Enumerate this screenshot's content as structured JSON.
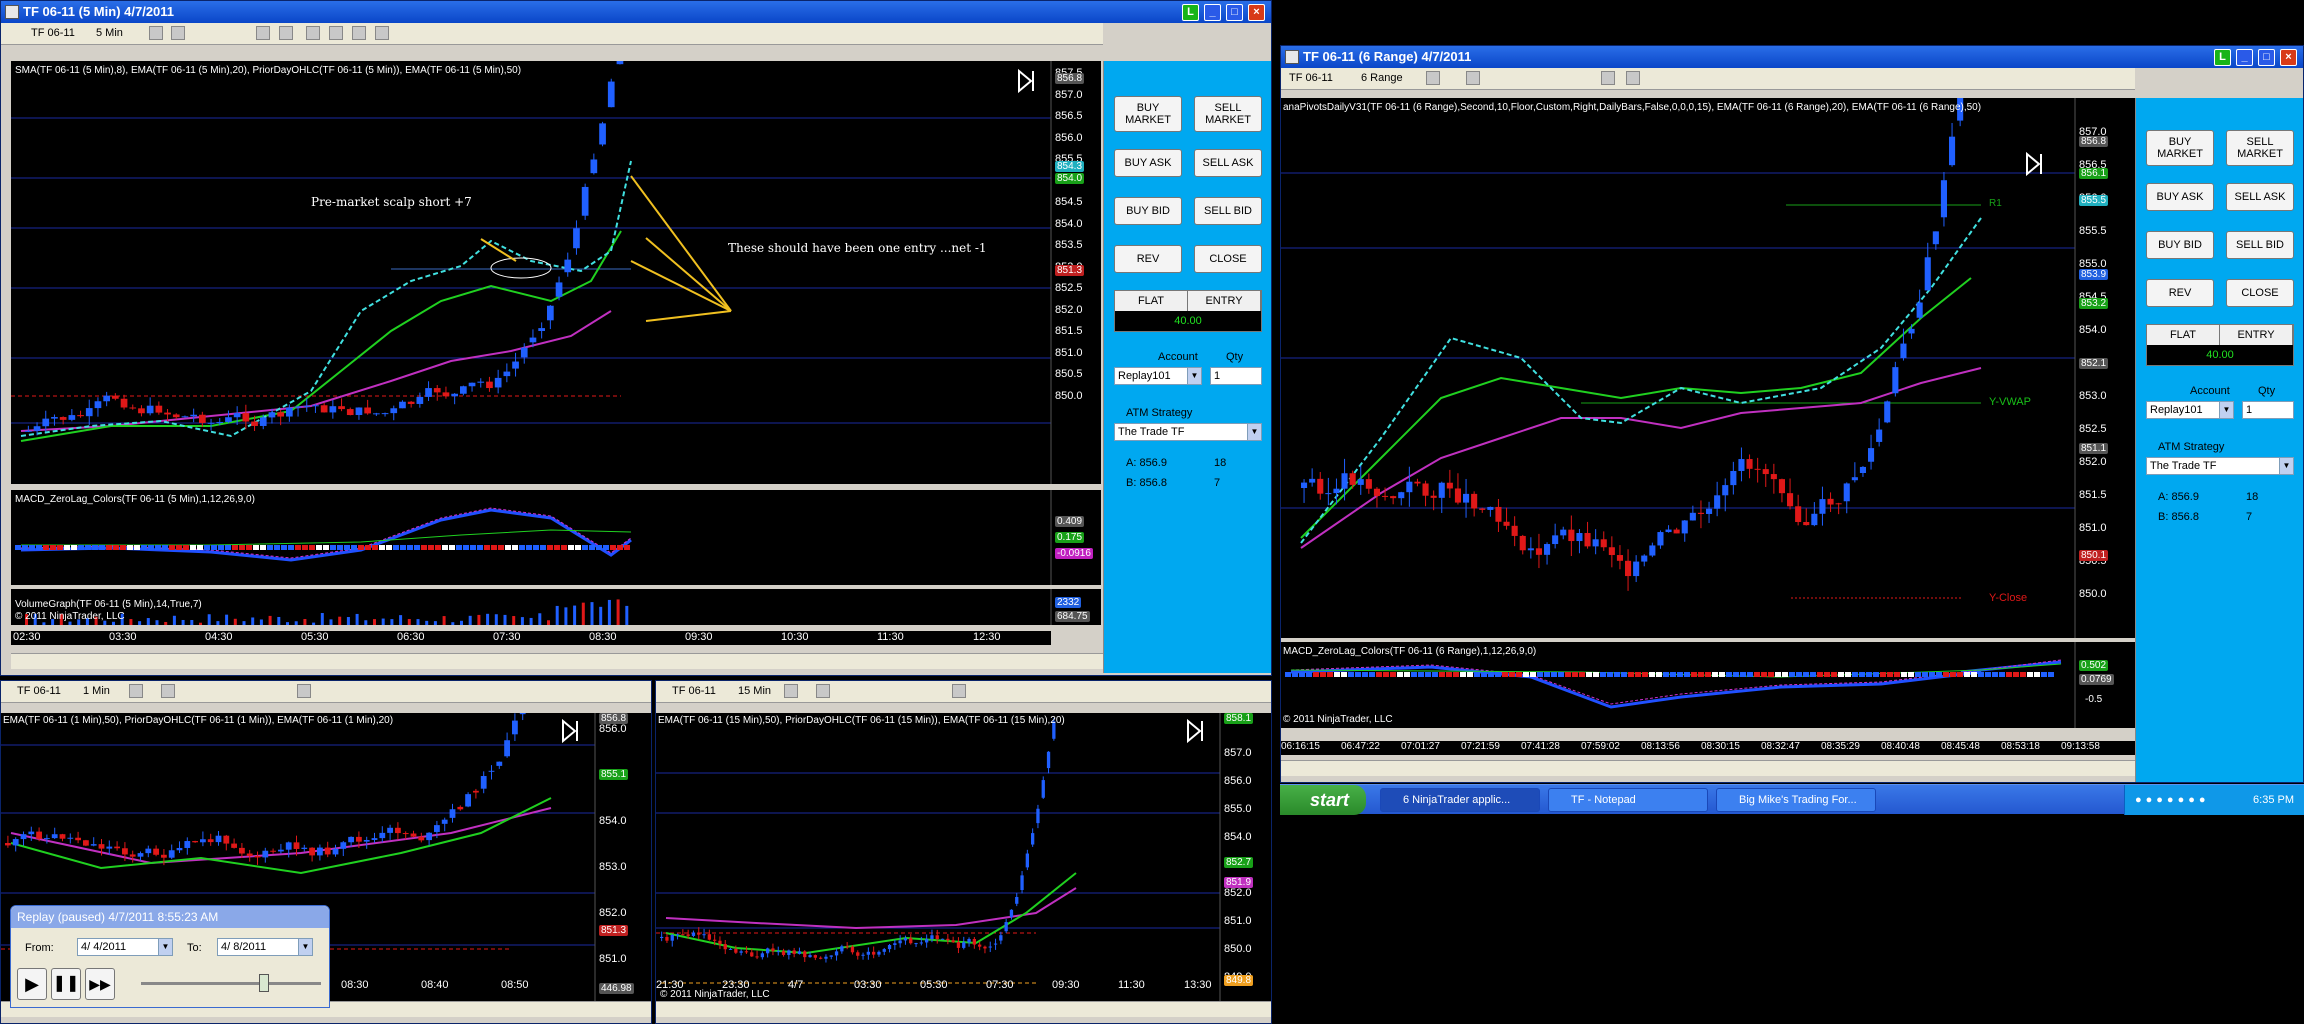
{
  "colors": {
    "chart_bg": "#000000",
    "sidebar": "#00a8f0",
    "up_bar": "#1e64ff",
    "down_bar": "#e01818",
    "ema20": "#20d020",
    "ema50": "#c030c0",
    "sma8": "#40e0e0",
    "gridline": "#1a2aa0"
  },
  "win_main": {
    "title": "TF 06-11 (5 Min)  4/7/2011",
    "instrument": "TF 06-11",
    "interval": "5 Min",
    "indicator_label": "SMA(TF 06-11 (5 Min),8), EMA(TF 06-11 (5 Min),20), PriorDayOHLC(TF 06-11 (5 Min)), EMA(TF 06-11 (5 Min),50)",
    "y_labels": [
      "857.5",
      "857.0",
      "856.5",
      "856.0",
      "855.5",
      "855.0",
      "854.5",
      "854.0",
      "853.5",
      "853.0",
      "852.5",
      "852.0",
      "851.5",
      "851.0",
      "850.5",
      "850.0"
    ],
    "price_tags": [
      "856.8",
      "854.3",
      "854.0",
      "851.3"
    ],
    "macd_label": "MACD_ZeroLag_Colors(TF 06-11 (5 Min),1,12,26,9,0)",
    "macd_tags": [
      "0.409",
      "0.175",
      "-0.0916"
    ],
    "volume_label": "VolumeGraph(TF 06-11 (5 Min),14,True,7)",
    "volume_tags": [
      "2332",
      "684.75"
    ],
    "copyright": "© 2011 NinjaTrader, LLC",
    "x_labels": [
      "02:30",
      "03:30",
      "04:30",
      "05:30",
      "06:30",
      "07:30",
      "08:30",
      "09:30",
      "10:30",
      "11:30",
      "12:30"
    ],
    "annotation1": "Pre-market scalp short +7",
    "annotation2": "These should have been one entry ...net -1"
  },
  "sidebar": {
    "buy_market": "BUY\nMARKET",
    "sell_market": "SELL\nMARKET",
    "buy_ask": "BUY ASK",
    "sell_ask": "SELL ASK",
    "buy_bid": "BUY BID",
    "sell_bid": "SELL BID",
    "rev": "REV",
    "close": "CLOSE",
    "flat": "FLAT",
    "entry": "ENTRY",
    "pnl": "40.00",
    "account_label": "Account",
    "qty_label": "Qty",
    "account": "Replay101",
    "qty": "1",
    "atm_label": "ATM Strategy",
    "atm": "The Trade TF",
    "ask": "A: 856.9",
    "ask_size": "18",
    "bid": "B: 856.8",
    "bid_size": "7"
  },
  "win_range": {
    "title": "TF 06-11 (6 Range)  4/7/2011",
    "instrument": "TF 06-11",
    "interval": "6 Range",
    "indicator_label": "anaPivotsDailyV31(TF 06-11 (6 Range),Second,10,Floor,Custom,Right,DailyBars,False,0,0,0,15), EMA(TF 06-11 (6 Range),20), EMA(TF 06-11 (6 Range),50)",
    "y_labels": [
      "857.0",
      "856.5",
      "856.0",
      "855.5",
      "855.0",
      "854.5",
      "854.0",
      "853.5",
      "853.0",
      "852.5",
      "852.0",
      "851.5",
      "851.0",
      "850.5",
      "850.0"
    ],
    "price_tags": [
      "856.8",
      "856.1",
      "855.5",
      "853.9",
      "853.2",
      "852.1",
      "851.1",
      "850.1"
    ],
    "r1": "R1",
    "yvwap": "Y-VWAP",
    "yclose": "Y-Close",
    "macd_label": "MACD_ZeroLag_Colors(TF 06-11 (6 Range),1,12,26,9,0)",
    "macd_tags": [
      "0.502",
      "0.0769"
    ],
    "macd_axis": "-0.5",
    "copyright": "© 2011 NinjaTrader, LLC",
    "x_labels": [
      "06:16:15",
      "06:47:22",
      "07:01:27",
      "07:21:59",
      "07:41:28",
      "07:59:02",
      "08:13:56",
      "08:30:15",
      "08:32:47",
      "08:35:29",
      "08:40:48",
      "08:45:48",
      "08:53:18",
      "09:13:58"
    ]
  },
  "win_1min": {
    "instrument": "TF 06-11",
    "interval": "1 Min",
    "indicator_label": "EMA(TF 06-11 (1 Min),50), PriorDayOHLC(TF 06-11 (1 Min)), EMA(TF 06-11 (1 Min),20)",
    "y_labels": [
      "856.0",
      "855.0",
      "854.0",
      "853.0",
      "852.0",
      "851.0"
    ],
    "price_tags": [
      "856.8",
      "855.1",
      "851.3",
      "446.98"
    ],
    "x_labels": [
      "08:30",
      "08:40",
      "08:50"
    ]
  },
  "win_15min": {
    "instrument": "TF 06-11",
    "interval": "15 Min",
    "indicator_label": "EMA(TF 06-11 (15 Min),50), PriorDayOHLC(TF 06-11 (15 Min)), EMA(TF 06-11 (15 Min),20)",
    "y_labels": [
      "857.0",
      "856.0",
      "855.0",
      "854.0",
      "853.0",
      "852.0",
      "851.0",
      "850.0",
      "849.0"
    ],
    "price_tags": [
      "858.1",
      "852.7",
      "851.9",
      "849.8"
    ],
    "copyright": "© 2011 NinjaTrader, LLC",
    "x_labels": [
      "21:30",
      "23:30",
      "4/7",
      "03:30",
      "05:30",
      "07:30",
      "09:30",
      "11:30",
      "13:30"
    ]
  },
  "replay": {
    "title": "Replay (paused) 4/7/2011 8:55:23 AM",
    "from_label": "From:",
    "from": "4/ 4/2011",
    "to_label": "To:",
    "to": "4/ 8/2011"
  },
  "taskbar": {
    "start": "start",
    "task1": "6 NinjaTrader applic...",
    "task2": "TF - Notepad",
    "task3": "Big Mike's Trading For...",
    "time": "6:35 PM"
  }
}
